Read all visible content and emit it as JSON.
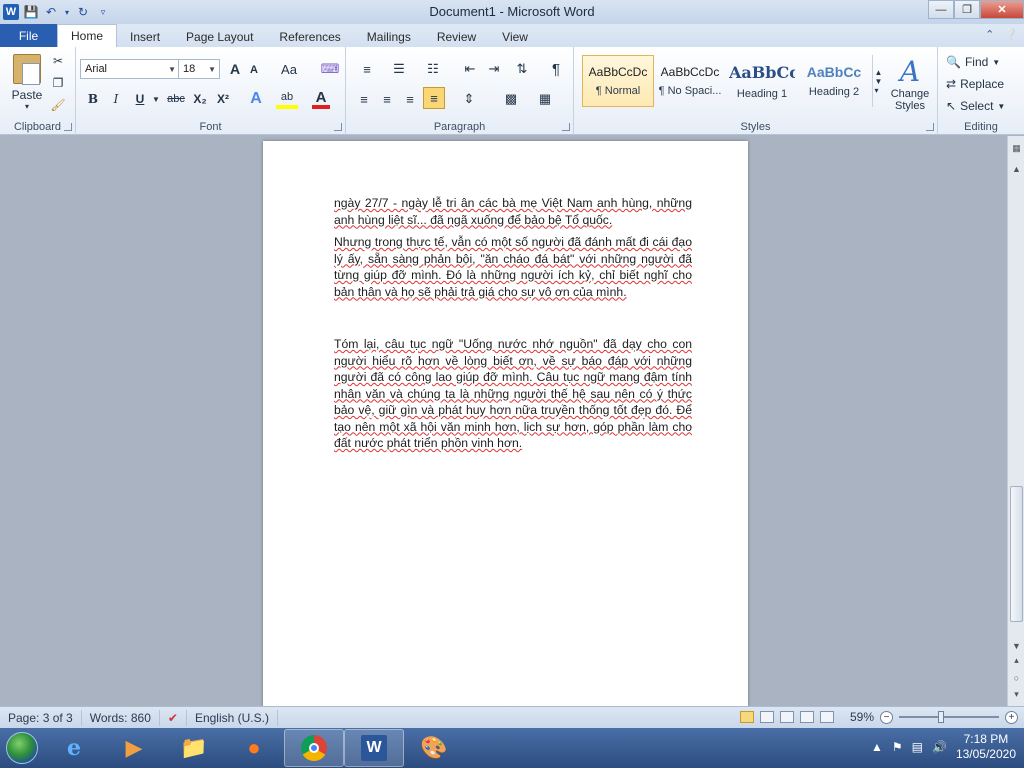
{
  "window": {
    "title": "Document1  -  Microsoft Word",
    "app_icon": "W",
    "controls": [
      "minimize-icon",
      "restore-icon",
      "close-icon"
    ]
  },
  "quick_access": [
    "save-icon",
    "undo-icon",
    "redo-icon",
    "customize-qat-icon"
  ],
  "tabs": {
    "file": "File",
    "items": [
      "Home",
      "Insert",
      "Page Layout",
      "References",
      "Mailings",
      "Review",
      "View"
    ],
    "active": "Home"
  },
  "ribbon": {
    "clipboard": {
      "label": "Clipboard",
      "paste": "Paste"
    },
    "font": {
      "label": "Font",
      "family": "Arial",
      "size": "18",
      "grow": "A",
      "shrink": "A",
      "change_case": "Aa",
      "bold": "B",
      "italic": "I",
      "underline": "U",
      "strike": "abc",
      "subscript": "X₂",
      "superscript": "X²",
      "text_effects": "A",
      "highlight": "ab",
      "font_color": "A",
      "font_color_hex": "#e02020"
    },
    "paragraph": {
      "label": "Paragraph",
      "pilcrow": "¶"
    },
    "styles": {
      "label": "Styles",
      "items": [
        {
          "sample": "AaBbCcDc",
          "name": "¶ Normal"
        },
        {
          "sample": "AaBbCcDc",
          "name": "¶ No Spaci..."
        },
        {
          "sample": "AaBbCc",
          "name": "Heading 1"
        },
        {
          "sample": "AaBbCc",
          "name": "Heading 2"
        }
      ],
      "change_styles": "Change Styles"
    },
    "editing": {
      "label": "Editing",
      "find": "Find",
      "replace": "Replace",
      "select": "Select"
    }
  },
  "document": {
    "paragraphs": [
      "ngày 27/7 - ngày lễ tri ân các bà mẹ Việt Nam anh hùng, những anh hùng liệt sĩ... đã ngã xuống để bảo bệ Tổ quốc.",
      "Nhưng trong thực tế, vẫn có một số người đã đánh mất đi cái đạo lý ấy, sẵn sàng phản bội, \"ăn cháo đá bát\" với những người đã từng giúp đỡ mình. Đó là những người ích kỷ, chỉ biết nghĩ cho bản thân và họ sẽ phải trả giá cho sự vô ơn của mình.",
      "Tóm lại, câu tục ngữ \"Uống nước nhớ nguồn\" đã dạy cho con người hiểu rõ hơn về lòng biết ơn, về sự báo đáp với những người đã có công lao giúp đỡ mình. Câu tục ngữ mang đậm tính nhân văn và chúng ta là những người thế hệ sau nên có ý thức bảo vệ, giữ gìn và phát huy hơn nữa truyền thống tốt đẹp đó. Để tạo nên một xã hội văn minh hơn, lịch sự hơn, góp phần làm cho đất nước phát triển phồn vinh hơn."
    ]
  },
  "status": {
    "page": "Page: 3 of 3",
    "words": "Words: 860",
    "language": "English (U.S.)",
    "zoom": "59%",
    "zoom_level": 0.59
  },
  "taskbar": {
    "apps": [
      "internet-explorer-icon",
      "media-player-icon",
      "file-explorer-icon",
      "firefox-icon",
      "chrome-icon",
      "word-icon",
      "paint-icon"
    ],
    "time": "7:18 PM",
    "date": "13/05/2020"
  }
}
